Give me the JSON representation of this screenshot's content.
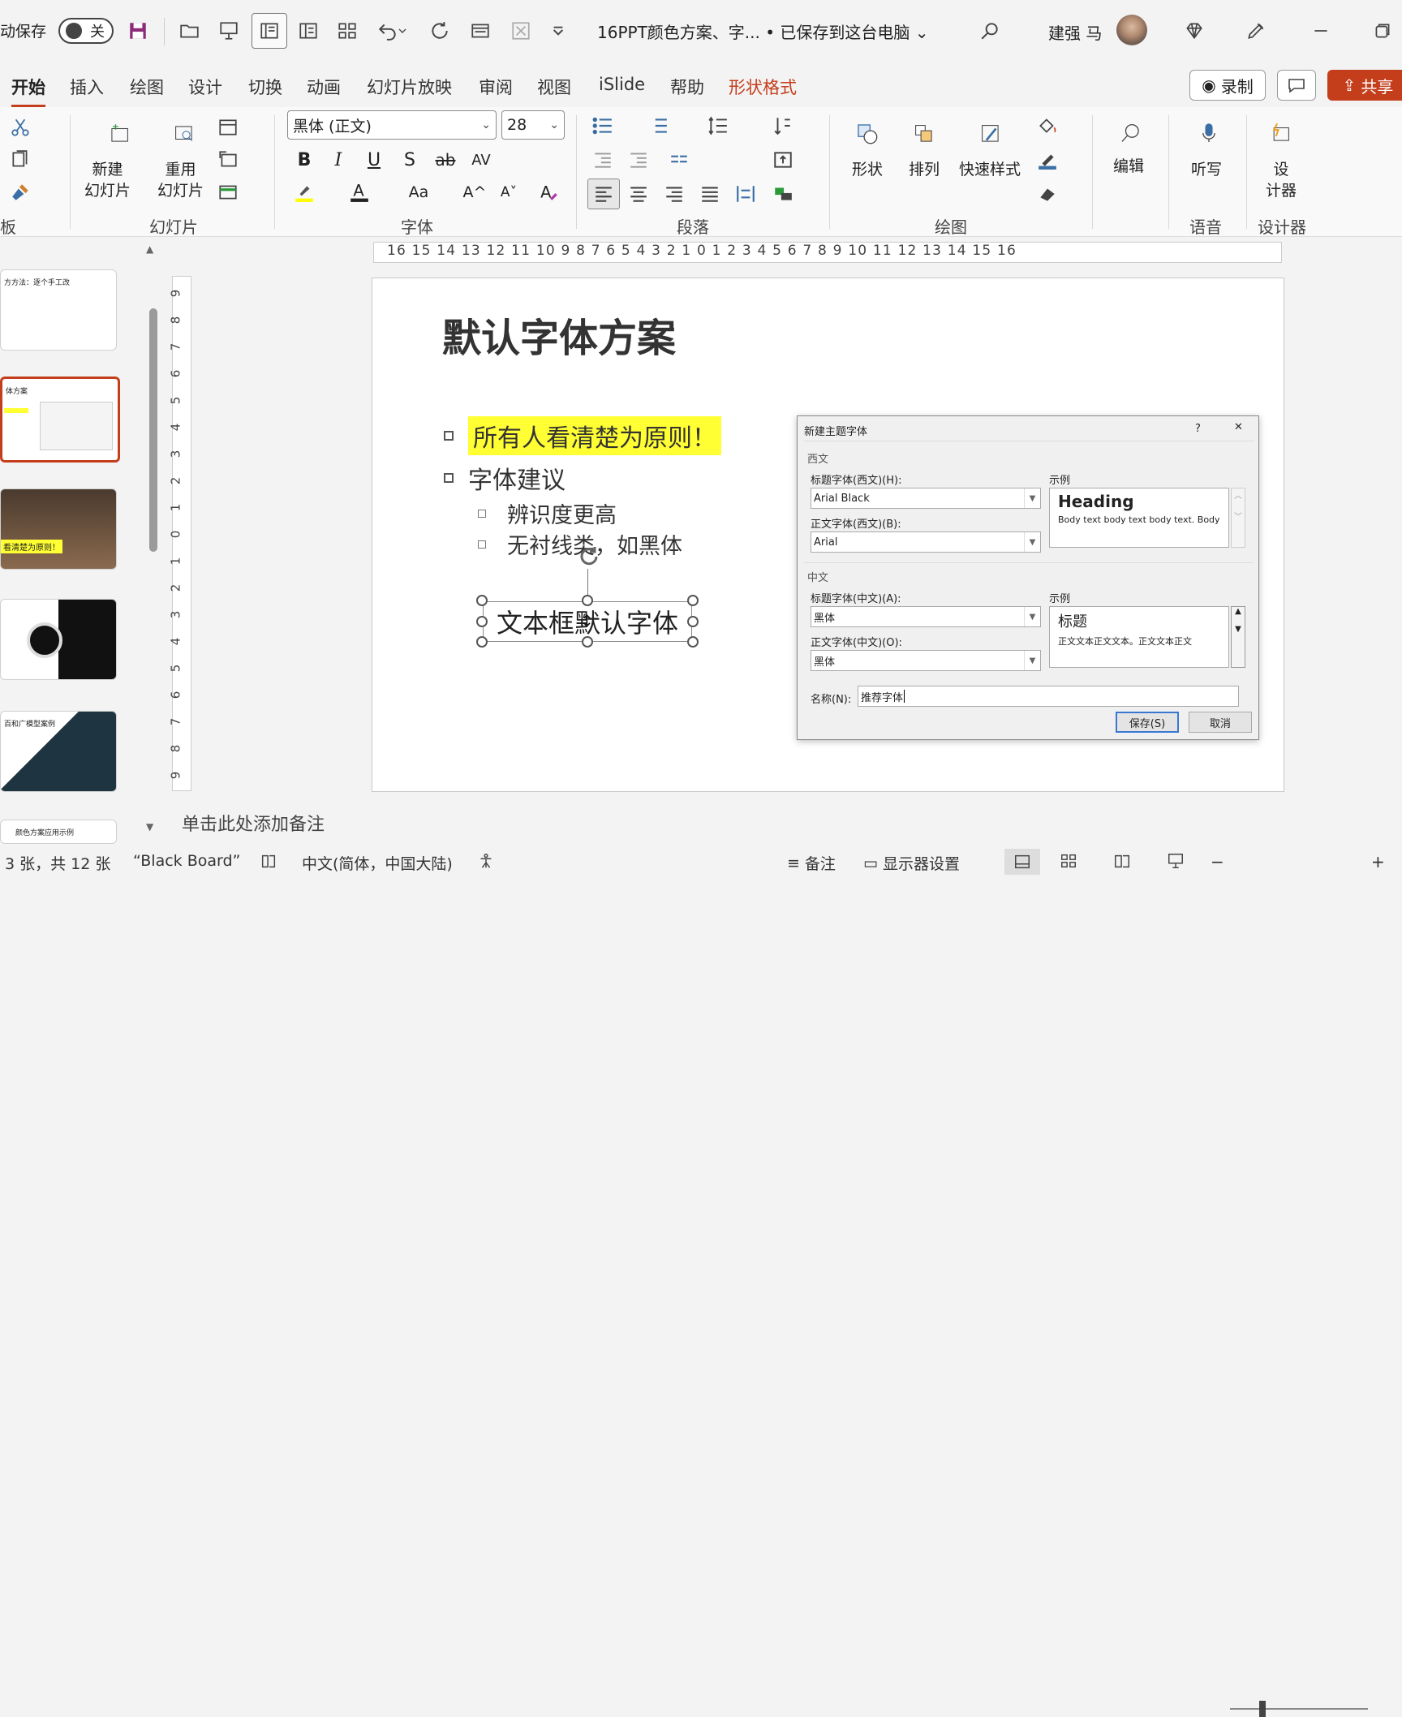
{
  "titlebar": {
    "autosave_label": "动保存",
    "autosave_state": "关",
    "doc_title": "16PPT颜色方案、字...  • 已保存到这台电脑",
    "user_name": "建强 马"
  },
  "tabs": [
    "开始",
    "插入",
    "绘图",
    "设计",
    "切换",
    "动画",
    "幻灯片放映",
    "审阅",
    "视图",
    "iSlide",
    "帮助",
    "形状格式"
  ],
  "top_buttons": {
    "record": "录制",
    "share": "共享"
  },
  "ribbon": {
    "clipboard_label": "板",
    "slides": {
      "new_slide": "新建\n幻灯片",
      "reuse_slide": "重用\n幻灯片",
      "label": "幻灯片"
    },
    "font": {
      "name": "黑体 (正文)",
      "size": "28",
      "label": "字体"
    },
    "paragraph": {
      "label": "段落"
    },
    "drawing": {
      "shape": "形状",
      "arrange": "排列",
      "quick_style": "快速样式",
      "label": "绘图"
    },
    "editing": {
      "edit": "编辑"
    },
    "voice": {
      "dictate": "听写",
      "label": "语音"
    },
    "designer": {
      "designer": "设\n计器",
      "label": "设计器"
    }
  },
  "ruler_h": "16 15 14 13 12 11 10 9 8 7 6 5 4 3 2 1 0 1 2 3 4 5 6 7 8 9 10 11 12 13 14 15 16",
  "ruler_v": [
    "9",
    "8",
    "7",
    "6",
    "5",
    "4",
    "3",
    "2",
    "1",
    "0",
    "1",
    "2",
    "3",
    "4",
    "5",
    "6",
    "7",
    "8",
    "9"
  ],
  "slide": {
    "title": "默认字体方案",
    "bullets": [
      "所有人看清楚为原则！",
      "字体建议"
    ],
    "subbullets": [
      "辨识度更高",
      "无衬线类，如黑体"
    ],
    "textbox": "文本框默认字体"
  },
  "thumbs": {
    "t1_title": "方方法：逐个手工改",
    "t2_title": "体方案",
    "t3_caption": "看清楚为原则！",
    "t5_title": "百和广模型案例",
    "t6_title": "颜色方案应用示例"
  },
  "dialog": {
    "title": "新建主题字体",
    "help": "?",
    "close": "✕",
    "western_section": "西文",
    "heading_font_w_label": "标题字体(西文)(H):",
    "heading_font_w": "Arial Black",
    "body_font_w_label": "正文字体(西文)(B):",
    "body_font_w": "Arial",
    "sample_label": "示例",
    "sample_heading": "Heading",
    "sample_body": "Body text body text body text. Body",
    "chinese_section": "中文",
    "heading_font_c_label": "标题字体(中文)(A):",
    "heading_font_c": "黑体",
    "body_font_c_label": "正文字体(中文)(O):",
    "body_font_c": "黑体",
    "sample_heading_c": "标题",
    "sample_body_c": "正文文本正文文本。正文文本正文",
    "name_label": "名称(N):",
    "name_value": "推荐字体",
    "save": "保存(S)",
    "cancel": "取消"
  },
  "notes_placeholder": "单击此处添加备注",
  "statusbar": {
    "slide_info": "3 张，共 12 张",
    "theme": "“Black Board”",
    "language": "中文(简体，中国大陆)",
    "notes": "备注",
    "display": "显示器设置"
  },
  "colors": {
    "accent": "#c43e1c",
    "highlight": "#ffff33"
  }
}
